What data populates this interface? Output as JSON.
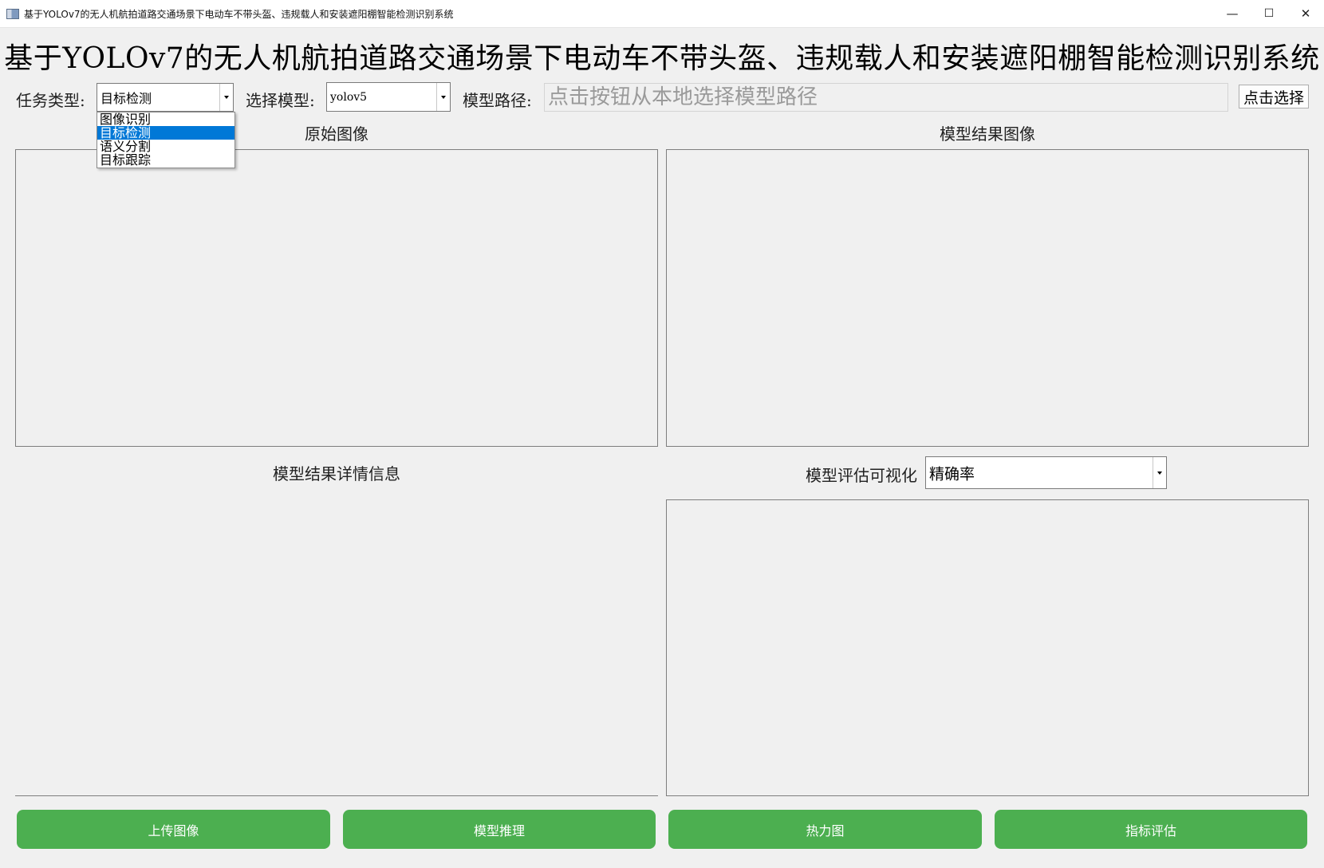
{
  "window": {
    "title": "基于YOLOv7的无人机航拍道路交通场景下电动车不带头盔、违规载人和安装遮阳棚智能检测识别系统",
    "controls": {
      "minimize": "—",
      "maximize": "☐",
      "close": "✕"
    }
  },
  "header": {
    "title": "基于YOLOv7的无人机航拍道路交通场景下电动车不带头盔、违规载人和安装遮阳棚智能检测识别系统"
  },
  "toolbar": {
    "task_type_label": "任务类型:",
    "task_type_value": "目标检测",
    "task_type_options": [
      "图像识别",
      "目标检测",
      "语义分割",
      "目标跟踪"
    ],
    "task_type_selected_index": 1,
    "model_label": "选择模型:",
    "model_value": "yolov5",
    "path_label": "模型路径:",
    "path_placeholder": "点击按钮从本地选择模型路径",
    "select_button": "点击选择"
  },
  "panels": {
    "original_title": "原始图像",
    "result_title": "模型结果图像",
    "details_title": "模型结果详情信息",
    "eval_title": "模型评估可视化",
    "eval_metric_value": "精确率"
  },
  "actions": {
    "upload": "上传图像",
    "infer": "模型推理",
    "heatmap": "热力图",
    "evaluate": "指标评估"
  },
  "colors": {
    "button_green": "#4caf50",
    "selection_blue": "#0078d7",
    "background": "#f0f0f0"
  }
}
